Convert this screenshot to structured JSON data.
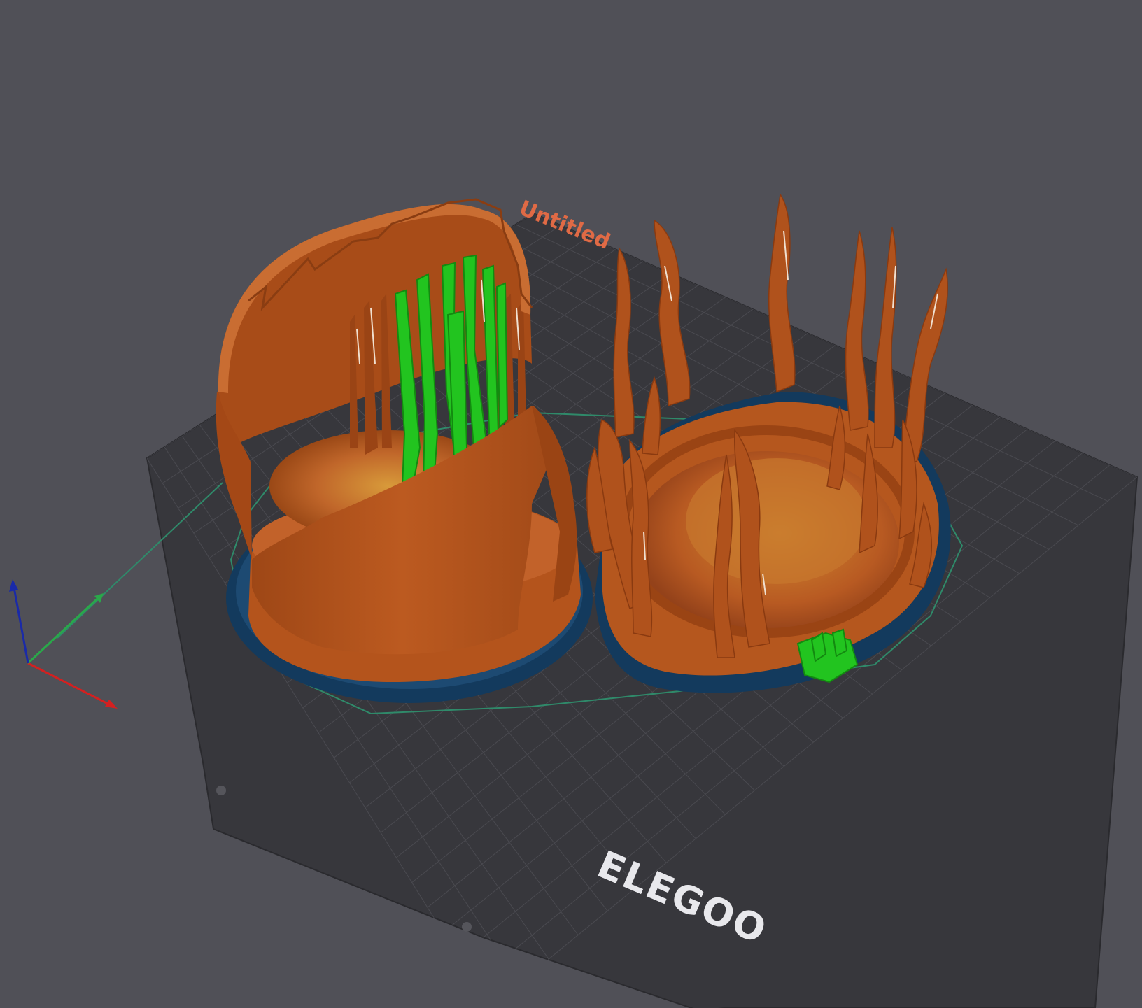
{
  "viewport": {
    "plate_name": "Untitled",
    "brand_logo": "ELEGOO"
  },
  "colors": {
    "background": "#505057",
    "bed": "#3a3a3f",
    "grid": "#4a4a50",
    "model": "#b5561e",
    "model_dark": "#8e3f12",
    "support": "#22c41f",
    "brim": "#143a5e",
    "skirt": "#2f8a6a",
    "axis_x": "#d42020",
    "axis_y": "#2aa84a",
    "axis_z": "#1a2aa8",
    "plate_label": "#e06a45"
  },
  "icons": {
    "axis": "xyz-axis-icon",
    "logo": "elegoo-logo"
  }
}
